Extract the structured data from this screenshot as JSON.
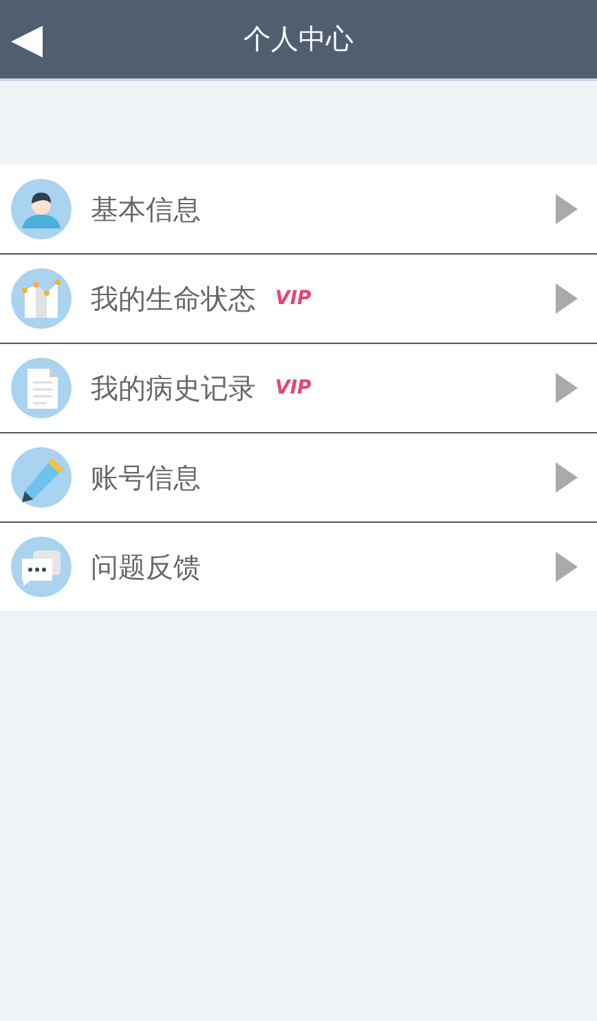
{
  "header": {
    "back": "◀",
    "title": "个人中心"
  },
  "menu": [
    {
      "kind": "person",
      "label": "基本信息"
    },
    {
      "kind": "chart",
      "label": "我的生命状态",
      "badge": "VIP"
    },
    {
      "kind": "document",
      "label": "我的病史记录",
      "badge": "VIP"
    },
    {
      "kind": "pencil",
      "label": "账号信息"
    },
    {
      "kind": "chat",
      "label": "问题反馈"
    }
  ]
}
